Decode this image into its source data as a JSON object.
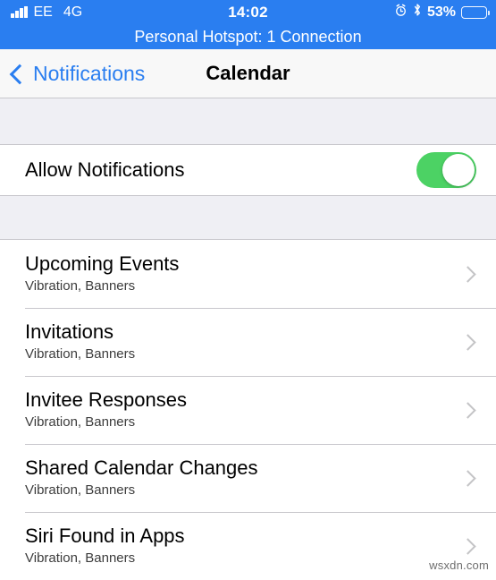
{
  "status_bar": {
    "signal_icon": "signal-bars-icon",
    "carrier": "EE",
    "network": "4G",
    "time": "14:02",
    "alarm_icon": "alarm-clock-icon",
    "bluetooth_icon": "bluetooth-icon",
    "battery_percent": "53%",
    "battery_level": 53,
    "background_color": "#2a7ef0"
  },
  "hotspot_banner": {
    "text": "Personal Hotspot: 1 Connection"
  },
  "navbar": {
    "back_label": "Notifications",
    "back_icon": "chevron-left-icon",
    "title": "Calendar",
    "accent_color": "#2a7ef0"
  },
  "allow_notifications": {
    "label": "Allow Notifications",
    "enabled": true,
    "switch_on_color": "#4cd264"
  },
  "alert_rows": [
    {
      "title": "Upcoming Events",
      "subtitle": "Vibration, Banners",
      "disclosure_icon": "chevron-right-icon"
    },
    {
      "title": "Invitations",
      "subtitle": "Vibration, Banners",
      "disclosure_icon": "chevron-right-icon"
    },
    {
      "title": "Invitee Responses",
      "subtitle": "Vibration, Banners",
      "disclosure_icon": "chevron-right-icon"
    },
    {
      "title": "Shared Calendar Changes",
      "subtitle": "Vibration, Banners",
      "disclosure_icon": "chevron-right-icon"
    },
    {
      "title": "Siri Found in Apps",
      "subtitle": "Vibration, Banners",
      "disclosure_icon": "chevron-right-icon"
    }
  ],
  "watermark": {
    "text": "wsxdn.com"
  }
}
